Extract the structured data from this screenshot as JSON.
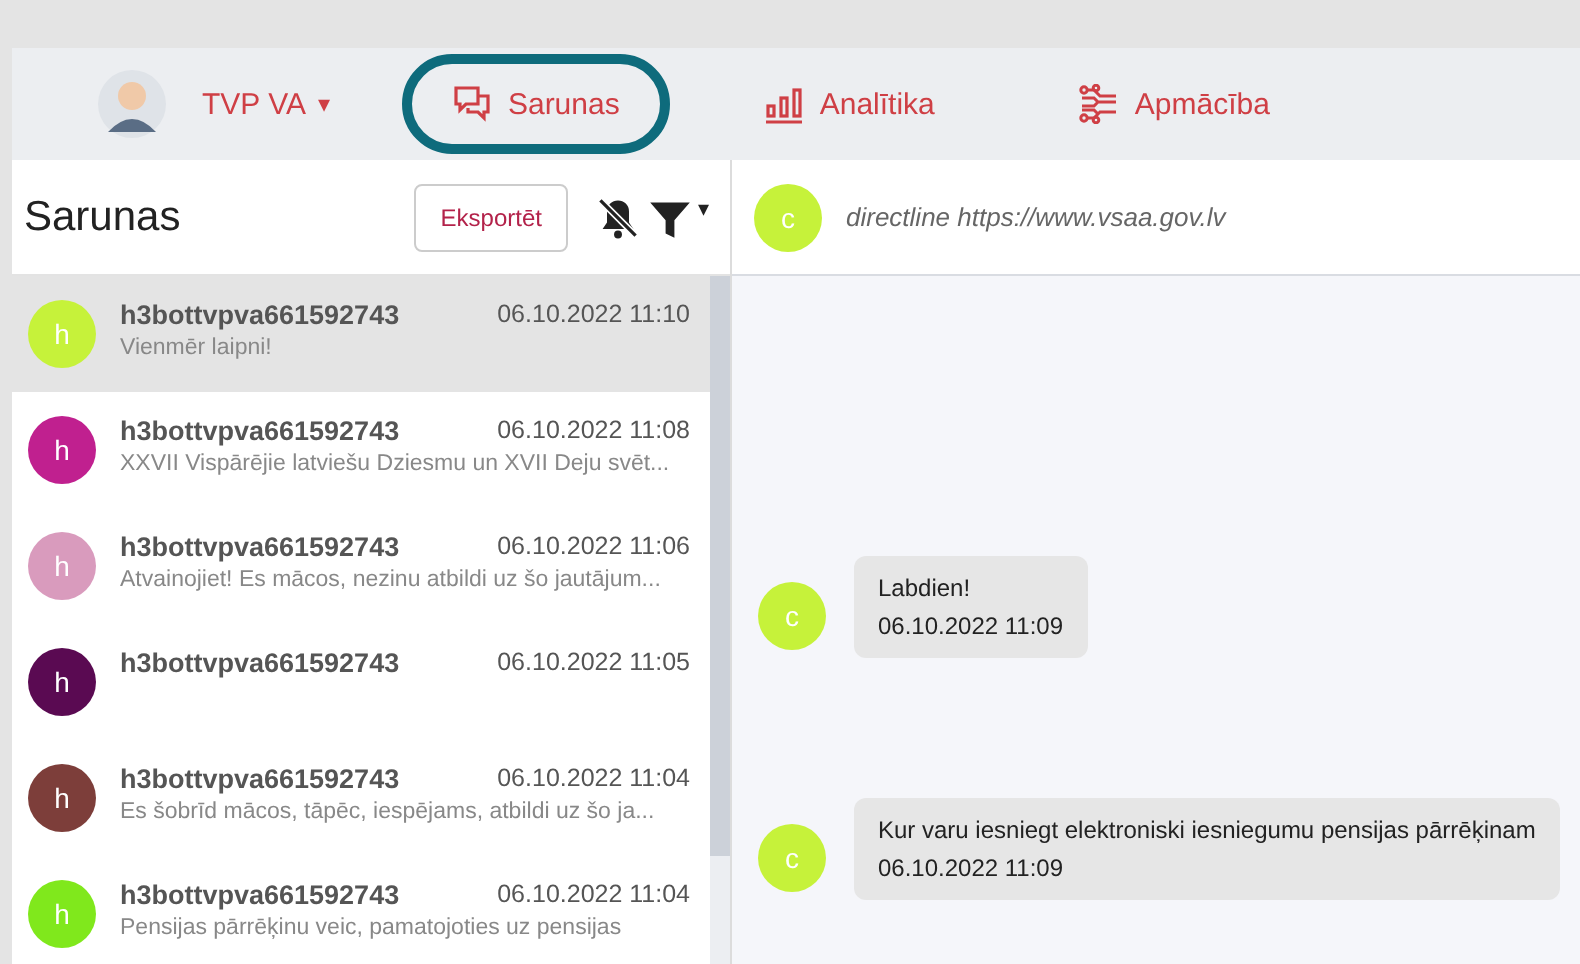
{
  "account": {
    "name": "TVP VA",
    "caret": "▾"
  },
  "nav": [
    {
      "label": "Sarunas",
      "kind": "chat",
      "selected": true
    },
    {
      "label": "Analītika",
      "kind": "bars",
      "selected": false
    },
    {
      "label": "Apmācība",
      "kind": "circuit",
      "selected": false
    }
  ],
  "sidebar": {
    "title": "Sarunas",
    "export_button": "Eksportēt",
    "filter_caret": "▾",
    "conversations": [
      {
        "avatar": "h",
        "color": "#c6f23a",
        "name": "h3bottvpva661592743",
        "time": "06.10.2022 11:10",
        "preview": "Vienmēr laipni!",
        "selected": true
      },
      {
        "avatar": "h",
        "color": "#c0208f",
        "name": "h3bottvpva661592743",
        "time": "06.10.2022 11:08",
        "preview": "XXVII Vispārējie latviešu Dziesmu un XVII Deju svēt...",
        "selected": false
      },
      {
        "avatar": "h",
        "color": "#d99bbd",
        "name": "h3bottvpva661592743",
        "time": "06.10.2022 11:06",
        "preview": "Atvainojiet! Es mācos, nezinu atbildi uz šo jautājum...",
        "selected": false
      },
      {
        "avatar": "h",
        "color": "#5a0a52",
        "name": "h3bottvpva661592743",
        "time": "06.10.2022 11:05",
        "selected": false
      },
      {
        "avatar": "h",
        "color": "#7d3e3a",
        "name": "h3bottvpva661592743",
        "time": "06.10.2022 11:04",
        "preview": "Es šobrīd mācos, tāpēc, iespējams, atbildi uz šo ja...",
        "selected": false
      },
      {
        "avatar": "h",
        "color": "#80e81c",
        "name": "h3bottvpva661592743",
        "time": "06.10.2022 11:04",
        "preview": "Pensijas pārrēķinu veic, pamatojoties uz pensijas",
        "selected": false
      }
    ]
  },
  "chat": {
    "avatar": "c",
    "title": "directline https://www.vsaa.gov.lv",
    "messages": [
      {
        "avatar": "c",
        "text": "Labdien!",
        "time": "06.10.2022 11:09"
      },
      {
        "avatar": "c",
        "text": "Kur varu iesniegt elektroniski iesniegumu pensijas pārrēķinam",
        "time": "06.10.2022 11:09"
      }
    ]
  }
}
